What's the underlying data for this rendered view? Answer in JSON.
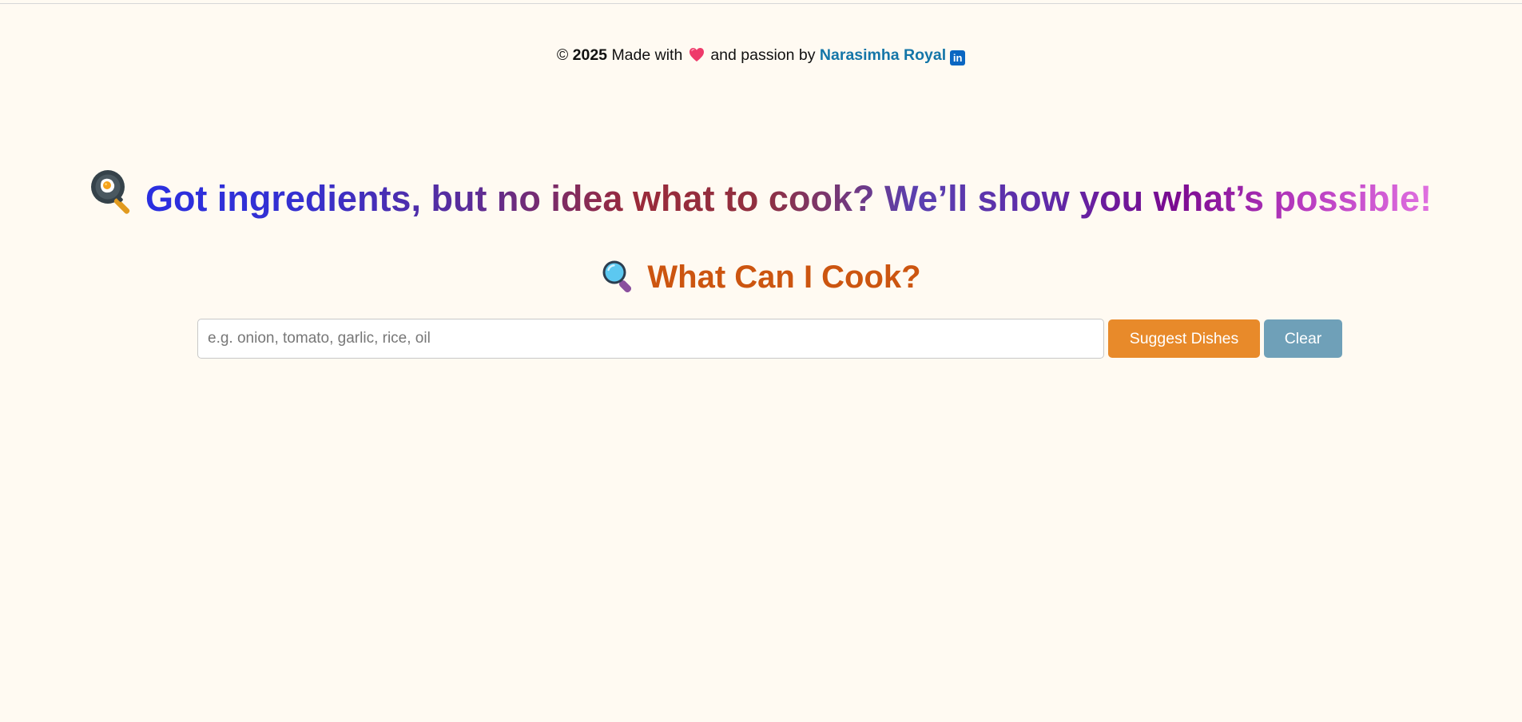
{
  "footer": {
    "copyright_symbol": "©",
    "year": "2025",
    "made_with": "Made with",
    "and_passion_by": "and passion by",
    "author_name": "Narasimha Royal",
    "icons": [
      "heart-icon",
      "linkedin-icon"
    ],
    "linkedin_glyph": "in"
  },
  "hero": {
    "icon": "frying-pan-egg-icon",
    "text": "Got ingredients, but no idea what to cook? We’ll show you what’s possible!"
  },
  "finder": {
    "icon": "magnifier-icon",
    "title": "What Can I Cook?",
    "input_placeholder": "e.g. onion, tomato, garlic, rice, oil",
    "input_value": "",
    "suggest_label": "Suggest Dishes",
    "clear_label": "Clear"
  },
  "colors": {
    "background": "#fffaf2",
    "author_link": "#1476a8",
    "subtitle": "#cc5510",
    "suggest_button": "#e88a2a",
    "clear_button": "#6fa0b8"
  }
}
